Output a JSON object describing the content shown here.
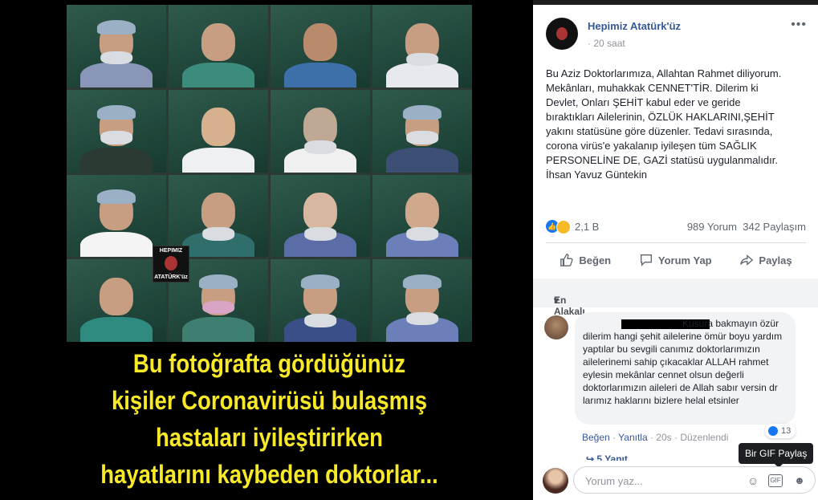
{
  "photo": {
    "logo_line1": "HEPIMIZ",
    "logo_line2": "ATATÜRK'üz",
    "caption_lines": [
      "Bu fotoğrafta gördüğünüz",
      "kişiler Coronavirüsü bulaşmış",
      "hastaları iyileştirirken",
      "hayatlarını kaybeden doktorlar..."
    ]
  },
  "post": {
    "page_name": "Hepimiz Atatürk'üz",
    "time": "20 saat",
    "privacy_separator": "·",
    "more_label": "•••",
    "text": "Bu Aziz Doktorlarımıza, Allahtan Rahmet diliyorum.\nMekânları, muhakkak CENNET'TİR. Dilerim ki\nDevlet, Onları ŞEHİT kabul eder ve geride\nbıraktıkları Ailelerinin, ÖZLÜK HAKLARINI,ŞEHİT\nyakını statüsüne göre düzenler. Tedavi sırasında,\ncorona virüs'e yakalanıp iyileşen tüm SAĞLIK\nPERSONELİNE DE, GAZİ statüsü uygulanmalıdır.\nİhsan Yavuz Güntekin",
    "reaction_count": "2,1 B",
    "comments_count": "989 Yorum",
    "shares_count": "342 Paylaşım",
    "actions": {
      "like": "Beğen",
      "comment": "Yorum Yap",
      "share": "Paylaş"
    }
  },
  "comments": {
    "sort_label": "En Alakalı",
    "first": {
      "text": "Kusura bakmayın özür dilerim hangi şehit ailelerine ömür boyu yardım yaptılar bu sevgili canımız doktorlarımızın ailelerinemi sahip çıkacaklar ALLAH rahmet eylesin mekânlar cennet olsun değerli doktorlarımızın aileleri de Allah sabır versin dr larımız haklarını bizlere helal etsinler",
      "like_count": "13",
      "like_label": "Beğen",
      "reply_label": "Yanıtla",
      "time": "20s",
      "edited": "Düzenlendi",
      "replies_label": "5 Yanıt"
    },
    "input_placeholder": "Yorum yaz...",
    "gif_tooltip": "Bir GIF Paylaş",
    "gif_icon_label": "GIF"
  },
  "colors": {
    "link_blue": "#365899",
    "caption_yellow": "#f7e928",
    "like_blue": "#1877f2"
  }
}
